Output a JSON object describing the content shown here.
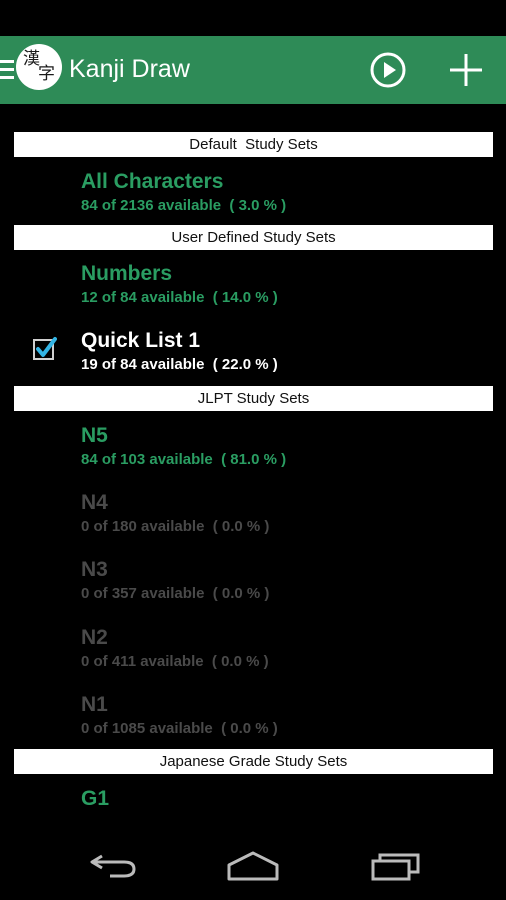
{
  "actionbar": {
    "title": "Kanji Draw",
    "app_icon": {
      "char1": "漢",
      "char2": "字"
    },
    "play_icon": "play-circle-icon",
    "add_icon": "plus-icon",
    "color": "#2e8b57"
  },
  "sections": {
    "default": "Default  Study Sets",
    "user": "User Defined Study Sets",
    "jlpt": "JLPT Study Sets",
    "grade": "Japanese Grade Study Sets"
  },
  "items": {
    "all_characters": {
      "name": "All Characters",
      "count": "84 of 2136 available  ( 3.0 % )"
    },
    "numbers": {
      "name": "Numbers",
      "count": "12 of 84 available  ( 14.0 % )"
    },
    "quick_list_1": {
      "name": "Quick List 1",
      "count": "19 of 84 available  ( 22.0 % )",
      "checked": true
    },
    "n5": {
      "name": "N5",
      "count": "84 of 103 available  ( 81.0 % )"
    },
    "n4": {
      "name": "N4",
      "count": "0 of 180 available  ( 0.0 % )"
    },
    "n3": {
      "name": "N3",
      "count": "0 of 357 available  ( 0.0 % )"
    },
    "n2": {
      "name": "N2",
      "count": "0 of 411 available  ( 0.0 % )"
    },
    "n1": {
      "name": "N1",
      "count": "0 of 1085 available  ( 0.0 % )"
    },
    "g1": {
      "name": "G1"
    }
  },
  "navbar": {
    "back_icon": "back-icon",
    "home_icon": "home-icon",
    "recents_icon": "recents-icon"
  },
  "colors": {
    "accent_green": "#2a9d62",
    "disabled_gray": "#4a4a4a",
    "checkbox_blue": "#33b5e5"
  }
}
